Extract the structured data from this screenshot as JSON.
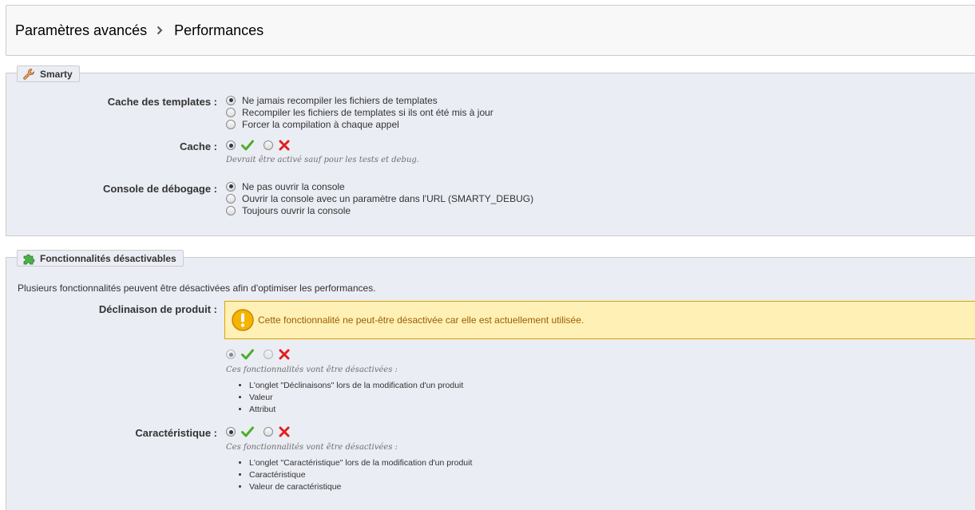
{
  "breadcrumb": {
    "parent": "Paramètres avancés",
    "current": "Performances"
  },
  "smarty": {
    "legend": "Smarty",
    "template_cache": {
      "label": "Cache des templates :",
      "options": [
        "Ne jamais recompiler les fichiers de templates",
        "Recompiler les fichiers de templates si ils ont été mis à jour",
        "Forcer la compilation à chaque appel"
      ],
      "selected": 0
    },
    "cache": {
      "label": "Cache :",
      "selected": "yes",
      "hint": "Devrait être activé sauf pour les tests et debug."
    },
    "debug_console": {
      "label": "Console de débogage :",
      "options": [
        "Ne pas ouvrir la console",
        "Ouvrir la console avec un paramètre dans l'URL (SMARTY_DEBUG)",
        "Toujours ouvrir la console"
      ],
      "selected": 0
    }
  },
  "features": {
    "legend": "Fonctionnalités désactivables",
    "intro": "Plusieurs fonctionnalités peuvent être désactivées afin d'optimiser les performances.",
    "combinations": {
      "label": "Déclinaison de produit :",
      "warning": "Cette fonctionnalité ne peut-être désactivée car elle est actuellement utilisée.",
      "selected": "yes",
      "disabled": true,
      "hint": "Ces fonctionnalités vont être désactivées :",
      "items": [
        "L'onglet \"Déclinaisons\" lors de la modification d'un produit",
        "Valeur",
        "Attribut"
      ]
    },
    "characteristic": {
      "label": "Caractéristique :",
      "selected": "yes",
      "hint": "Ces fonctionnalités vont être désactivées :",
      "items": [
        "L'onglet \"Caractéristique\" lors de la modification d'un produit",
        "Caractéristique",
        "Valeur de caractéristique"
      ]
    }
  },
  "colors": {
    "check": "#4caf28",
    "cross": "#e02020",
    "warning_bg": "#fff1b5",
    "warning_border": "#e0a000"
  }
}
